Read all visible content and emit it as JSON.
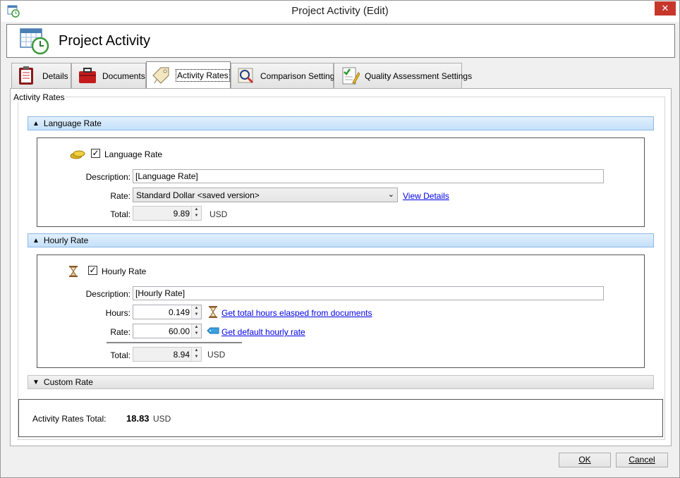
{
  "window": {
    "title": "Project Activity (Edit)",
    "close_glyph": "✕",
    "app_icon": "calendar-clock-icon"
  },
  "header": {
    "title": "Project Activity",
    "icon": "calendar-clock-icon"
  },
  "tabs": [
    {
      "label": "Details",
      "icon": "clipboard-icon",
      "active": false
    },
    {
      "label": "Documents",
      "icon": "briefcase-icon",
      "active": false
    },
    {
      "label": "Activity Rates",
      "icon": "price-tag-icon",
      "active": true
    },
    {
      "label": "Comparison Settings",
      "icon": "comparison-icon",
      "active": false
    },
    {
      "label": "Quality Assessment Settings",
      "icon": "checklist-pencil-icon",
      "active": false
    }
  ],
  "activity_rates": {
    "group_title": "Activity Rates",
    "language_section": {
      "header": "Language Rate",
      "arrow": "▲",
      "checkbox_label": "Language Rate",
      "checked": true,
      "description_label": "Description:",
      "description_value": "[Language Rate]",
      "rate_label": "Rate:",
      "rate_value": "Standard Dollar <saved version>",
      "view_details": "View Details",
      "total_label": "Total:",
      "total_value": "9.89",
      "currency": "USD"
    },
    "hourly_section": {
      "header": "Hourly Rate",
      "arrow": "▲",
      "checkbox_label": "Hourly Rate",
      "checked": true,
      "description_label": "Description:",
      "description_value": "[Hourly Rate]",
      "hours_label": "Hours:",
      "hours_value": "0.149",
      "hours_link": "Get total hours elasped from documents",
      "rate_label": "Rate:",
      "rate_value": "60.00",
      "rate_link": "Get default hourly rate",
      "total_label": "Total:",
      "total_value": "8.94",
      "currency": "USD"
    },
    "custom_section": {
      "header": "Custom Rate",
      "arrow": "▼"
    },
    "summary": {
      "label": "Activity Rates Total:",
      "value": "18.83",
      "currency": "USD"
    }
  },
  "buttons": {
    "ok": "OK",
    "cancel": "Cancel"
  },
  "colors": {
    "section_blue": "#c4e0fa",
    "link": "#0000e6",
    "close": "#c7362b"
  }
}
